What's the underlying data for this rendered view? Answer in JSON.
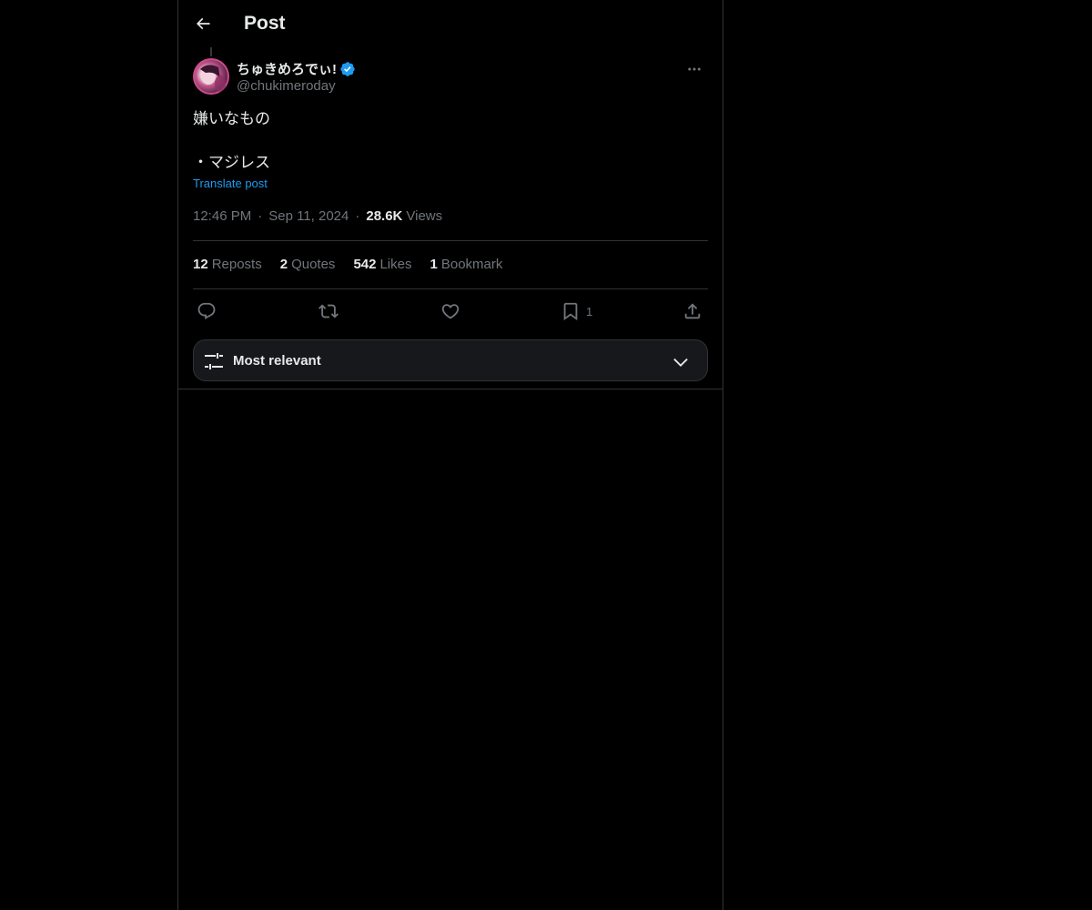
{
  "header": {
    "title": "Post",
    "back_icon": "arrow-left-icon"
  },
  "author": {
    "name": "ちゅきめろでぃ!",
    "handle": "@chukimeroday",
    "verified": true,
    "verified_color": "#1d9bf0"
  },
  "post": {
    "text": "嫌いなもの\n\n・マジレス",
    "translate_label": "Translate post",
    "time": "12:46 PM",
    "date": "Sep 11, 2024",
    "views_count": "28.6K",
    "views_label": "Views"
  },
  "stats": [
    {
      "num": "12",
      "label": "Reposts"
    },
    {
      "num": "2",
      "label": "Quotes"
    },
    {
      "num": "542",
      "label": "Likes"
    },
    {
      "num": "1",
      "label": "Bookmark"
    }
  ],
  "actions": {
    "reply_icon": "reply-icon",
    "repost_icon": "repost-icon",
    "like_icon": "heart-icon",
    "bookmark_icon": "bookmark-icon",
    "bookmark_count": "1",
    "share_icon": "share-icon"
  },
  "sort": {
    "label": "Most relevant",
    "icon": "filter-sliders-icon"
  },
  "colors": {
    "background": "#000000",
    "text": "#e7e9ea",
    "secondary": "#71767b",
    "link": "#1d9bf0",
    "border": "#2f3336"
  }
}
